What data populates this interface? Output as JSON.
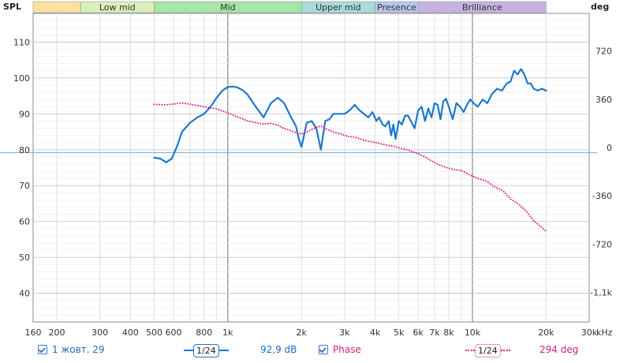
{
  "axes": {
    "left_title": "SPL",
    "right_title": "deg",
    "x_unit": "kHz"
  },
  "bands": [
    {
      "label": "",
      "from": 160,
      "to": 250,
      "color": "#fbe2a0"
    },
    {
      "label": "Low mid",
      "from": 250,
      "to": 500,
      "color": "#d9efb7"
    },
    {
      "label": "Mid",
      "from": 500,
      "to": 2000,
      "color": "#a6e6a6"
    },
    {
      "label": "Upper mid",
      "from": 2000,
      "to": 4000,
      "color": "#a6dcd9"
    },
    {
      "label": "Presence",
      "from": 4000,
      "to": 6000,
      "color": "#b6c6ec"
    },
    {
      "label": "Brilliance",
      "from": 6000,
      "to": 20000,
      "color": "#c6b2e0"
    }
  ],
  "legend": {
    "spl_label": "1 жовт. 29",
    "spl_smoothing": "1/24",
    "spl_value": "92,9 dB",
    "phase_label": "Phase",
    "phase_smoothing": "1/24",
    "phase_value": "294 deg"
  },
  "chart_data": {
    "type": "line",
    "x_scale": "log",
    "xlim": [
      160,
      30000
    ],
    "ylim_left": [
      32,
      118
    ],
    "ylim_right": [
      -1300,
      1000
    ],
    "x_ticks": [
      {
        "v": 160,
        "label": "160"
      },
      {
        "v": 200,
        "label": "200"
      },
      {
        "v": 300,
        "label": "300"
      },
      {
        "v": 400,
        "label": "400"
      },
      {
        "v": 500,
        "label": "500"
      },
      {
        "v": 600,
        "label": "600"
      },
      {
        "v": 800,
        "label": "800"
      },
      {
        "v": 1000,
        "label": "1k"
      },
      {
        "v": 2000,
        "label": "2k"
      },
      {
        "v": 3000,
        "label": "3k"
      },
      {
        "v": 4000,
        "label": "4k"
      },
      {
        "v": 5000,
        "label": "5k"
      },
      {
        "v": 6000,
        "label": "6k"
      },
      {
        "v": 7000,
        "label": "7k"
      },
      {
        "v": 8000,
        "label": "8k"
      },
      {
        "v": 10000,
        "label": "10k"
      },
      {
        "v": 20000,
        "label": "20k"
      },
      {
        "v": 30000,
        "label": "30k"
      }
    ],
    "y_ticks_left": [
      {
        "v": 40,
        "label": "40"
      },
      {
        "v": 50,
        "label": "50"
      },
      {
        "v": 60,
        "label": "60"
      },
      {
        "v": 70,
        "label": "70"
      },
      {
        "v": 80,
        "label": "80"
      },
      {
        "v": 90,
        "label": "90"
      },
      {
        "v": 100,
        "label": "100"
      },
      {
        "v": 110,
        "label": "110"
      }
    ],
    "y_ticks_right": [
      {
        "v": 720,
        "label": "720"
      },
      {
        "v": 360,
        "label": "360"
      },
      {
        "v": 0,
        "label": "0"
      },
      {
        "v": -360,
        "label": "-360"
      },
      {
        "v": -720,
        "label": "-720"
      },
      {
        "v": -1080,
        "label": "-1,1k"
      }
    ],
    "reference_line_left": 79.2,
    "series": [
      {
        "name": "1 жовт. 29",
        "axis": "left",
        "color": "#1c78d0",
        "style": "solid",
        "points": [
          [
            500,
            77.8
          ],
          [
            530,
            77.5
          ],
          [
            560,
            76.5
          ],
          [
            590,
            77.5
          ],
          [
            620,
            81
          ],
          [
            650,
            85
          ],
          [
            700,
            87.5
          ],
          [
            750,
            89
          ],
          [
            800,
            90
          ],
          [
            850,
            92
          ],
          [
            900,
            94.5
          ],
          [
            950,
            96.5
          ],
          [
            1000,
            97.5
          ],
          [
            1050,
            97.6
          ],
          [
            1100,
            97.3
          ],
          [
            1150,
            96.6
          ],
          [
            1200,
            95.5
          ],
          [
            1300,
            92
          ],
          [
            1400,
            89
          ],
          [
            1500,
            93
          ],
          [
            1600,
            94.5
          ],
          [
            1700,
            93
          ],
          [
            1800,
            89.5
          ],
          [
            1900,
            86.5
          ],
          [
            1950,
            83
          ],
          [
            2000,
            80.8
          ],
          [
            2050,
            84
          ],
          [
            2100,
            87.5
          ],
          [
            2200,
            88
          ],
          [
            2300,
            86
          ],
          [
            2400,
            80
          ],
          [
            2500,
            88
          ],
          [
            2600,
            88.5
          ],
          [
            2700,
            90
          ],
          [
            2850,
            90
          ],
          [
            3000,
            90
          ],
          [
            3150,
            91
          ],
          [
            3300,
            92.5
          ],
          [
            3450,
            91
          ],
          [
            3600,
            90
          ],
          [
            3750,
            89
          ],
          [
            3900,
            90.5
          ],
          [
            4050,
            88
          ],
          [
            4150,
            89
          ],
          [
            4300,
            87
          ],
          [
            4400,
            86.5
          ],
          [
            4550,
            88
          ],
          [
            4650,
            84
          ],
          [
            4750,
            87
          ],
          [
            4850,
            83
          ],
          [
            5000,
            88
          ],
          [
            5150,
            87
          ],
          [
            5300,
            89.5
          ],
          [
            5450,
            89.5
          ],
          [
            5600,
            88
          ],
          [
            5800,
            86
          ],
          [
            6000,
            91
          ],
          [
            6200,
            92
          ],
          [
            6400,
            88
          ],
          [
            6600,
            91.5
          ],
          [
            6800,
            89
          ],
          [
            7000,
            93
          ],
          [
            7200,
            92.5
          ],
          [
            7400,
            88.5
          ],
          [
            7600,
            93.5
          ],
          [
            7800,
            94.2
          ],
          [
            8000,
            92
          ],
          [
            8300,
            88.5
          ],
          [
            8600,
            93
          ],
          [
            8900,
            92
          ],
          [
            9200,
            90.5
          ],
          [
            9500,
            92.5
          ],
          [
            9800,
            94
          ],
          [
            10100,
            93
          ],
          [
            10500,
            92
          ],
          [
            11000,
            94
          ],
          [
            11500,
            93
          ],
          [
            12000,
            95.5
          ],
          [
            12600,
            97
          ],
          [
            13200,
            96.5
          ],
          [
            13800,
            98.5
          ],
          [
            14300,
            99
          ],
          [
            14800,
            102
          ],
          [
            15300,
            101
          ],
          [
            15800,
            102.5
          ],
          [
            16300,
            101
          ],
          [
            16800,
            98.5
          ],
          [
            17300,
            98.5
          ],
          [
            17800,
            97
          ],
          [
            18500,
            96.5
          ],
          [
            19200,
            97
          ],
          [
            20000,
            96.5
          ]
        ]
      },
      {
        "name": "Phase",
        "axis": "right",
        "color": "#e0228a",
        "style": "dotted",
        "points": [
          [
            500,
            322
          ],
          [
            550,
            318
          ],
          [
            600,
            324
          ],
          [
            650,
            333
          ],
          [
            700,
            323
          ],
          [
            800,
            304
          ],
          [
            900,
            288
          ],
          [
            1000,
            258
          ],
          [
            1100,
            227
          ],
          [
            1200,
            200
          ],
          [
            1300,
            185
          ],
          [
            1400,
            175
          ],
          [
            1500,
            180
          ],
          [
            1600,
            167
          ],
          [
            1700,
            142
          ],
          [
            1800,
            128
          ],
          [
            1900,
            110
          ],
          [
            2000,
            102
          ],
          [
            2100,
            115
          ],
          [
            2200,
            135
          ],
          [
            2300,
            150
          ],
          [
            2400,
            160
          ],
          [
            2500,
            141
          ],
          [
            2700,
            115
          ],
          [
            2900,
            102
          ],
          [
            3100,
            82
          ],
          [
            3300,
            78
          ],
          [
            3600,
            54
          ],
          [
            3900,
            43
          ],
          [
            4200,
            28
          ],
          [
            4500,
            17
          ],
          [
            4800,
            8
          ],
          [
            5100,
            -6
          ],
          [
            5400,
            -16
          ],
          [
            5700,
            -32
          ],
          [
            6000,
            -46
          ],
          [
            6400,
            -70
          ],
          [
            6800,
            -100
          ],
          [
            7300,
            -128
          ],
          [
            7800,
            -148
          ],
          [
            8400,
            -164
          ],
          [
            9000,
            -170
          ],
          [
            9700,
            -202
          ],
          [
            10500,
            -230
          ],
          [
            11400,
            -250
          ],
          [
            12300,
            -293
          ],
          [
            13300,
            -320
          ],
          [
            14300,
            -383
          ],
          [
            15400,
            -420
          ],
          [
            16500,
            -470
          ],
          [
            17700,
            -540
          ],
          [
            18800,
            -582
          ],
          [
            20000,
            -623
          ]
        ]
      }
    ]
  }
}
